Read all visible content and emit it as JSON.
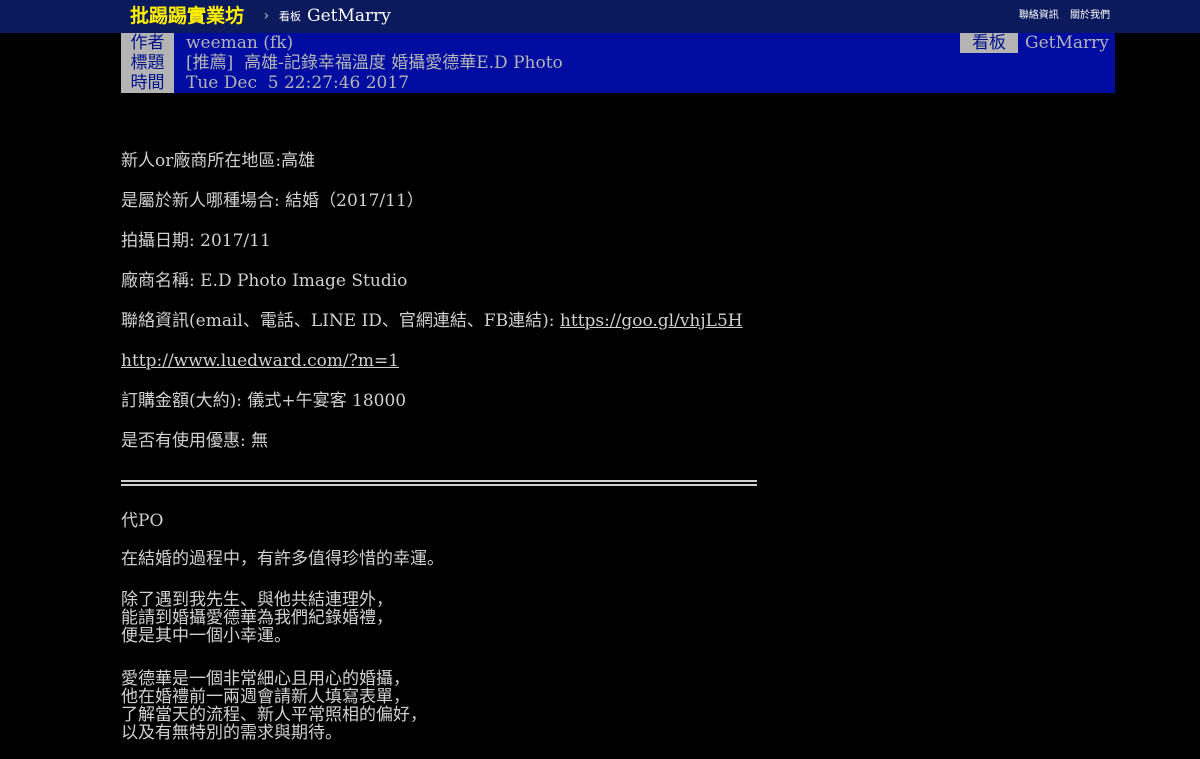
{
  "topbar": {
    "site_name": "批踢踢實業坊",
    "arrow": "›",
    "board_label": "看板",
    "board_name": "GetMarry",
    "links": [
      "聯絡資訊",
      "關於我們"
    ]
  },
  "meta": {
    "author_tag": "作者",
    "author": "weeman (fk)",
    "board_tag": "看板",
    "board": "GetMarry",
    "title_tag": "標題",
    "title": "[推薦]  高雄-記錄幸福溫度 婚攝愛德華E.D Photo",
    "time_tag": "時間",
    "time": "Tue Dec  5 22:27:46 2017"
  },
  "content": {
    "region": "新人or廠商所在地區:高雄",
    "occasion": "是屬於新人哪種場合: 結婚（2017/11）",
    "shoot_date": "拍攝日期: 2017/11",
    "vendor": "廠商名稱: E.D Photo Image Studio",
    "contact_label": "聯絡資訊(email、電話、LINE ID、官網連結、FB連結): ",
    "contact_link": "https://goo.gl/vhjL5H",
    "site_link": "http://www.luedward.com/?m=1",
    "price": "訂購金額(大約): 儀式+午宴客 18000",
    "discount": "是否有使用優惠: 無",
    "proxy": "代PO",
    "p1": "在結婚的過程中，有許多值得珍惜的幸運。",
    "p2": [
      "除了遇到我先生、與他共結連理外，",
      "能請到婚攝愛德華為我們紀錄婚禮，",
      "便是其中一個小幸運。"
    ],
    "p3": [
      "愛德華是一個非常細心且用心的婚攝，",
      "他在婚禮前一兩週會請新人填寫表單，",
      "了解當天的流程、新人平常照相的偏好，",
      "以及有無特別的需求與期待。"
    ]
  },
  "colors": {
    "topbar_bg": "#0b1a5c",
    "logo": "#fff000",
    "meta_bg": "#000da0",
    "tag_bg": "#b4b4b4",
    "tag_text": "#00108c",
    "body_bg": "#000000",
    "text": "#d0d0d0"
  }
}
